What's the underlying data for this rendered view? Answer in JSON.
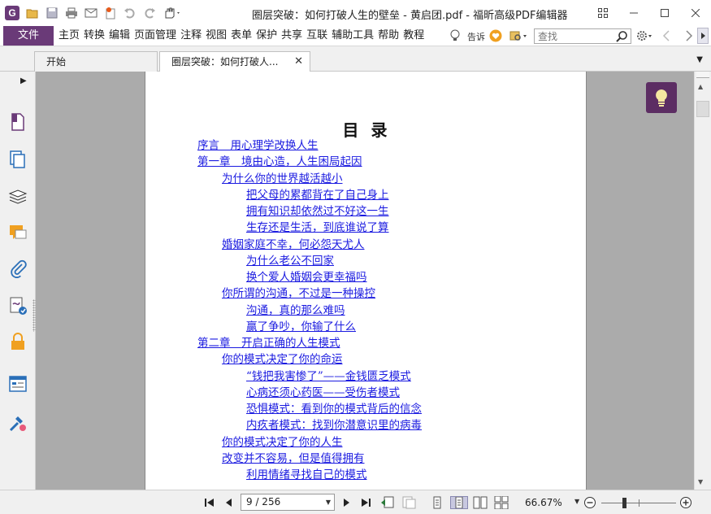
{
  "window": {
    "title": "圈层突破：如何打破人生的壁垒 - 黄启团.pdf - 福昕高级PDF编辑器",
    "app_logo": "G"
  },
  "menu": {
    "file_label": "文件",
    "items": [
      "主页",
      "转换",
      "编辑",
      "页面管理",
      "注释",
      "视图",
      "表单",
      "保护",
      "共享",
      "互联",
      "辅助工具",
      "帮助",
      "教程"
    ],
    "tell_label": "告诉",
    "search_placeholder": "查找"
  },
  "tabs": [
    {
      "label": "开始"
    },
    {
      "label": "圈层突破：如何打破人..."
    }
  ],
  "document": {
    "toc_title": "目 录",
    "entries": [
      {
        "level": 0,
        "text": "序言　用心理学改换人生"
      },
      {
        "level": 0,
        "text": "第一章　境由心造，人生困局起因"
      },
      {
        "level": 1,
        "text": "为什么你的世界越活越小"
      },
      {
        "level": 2,
        "text": "把父母的累都背在了自己身上"
      },
      {
        "level": 2,
        "text": "拥有知识却依然过不好这一生"
      },
      {
        "level": 2,
        "text": "生存还是生活，到底谁说了算"
      },
      {
        "level": 1,
        "text": "婚姻家庭不幸，何必怨天尤人"
      },
      {
        "level": 2,
        "text": "为什么老公不回家"
      },
      {
        "level": 2,
        "text": "换个爱人婚姻会更幸福吗"
      },
      {
        "level": 1,
        "text": "你所谓的沟通，不过是一种操控"
      },
      {
        "level": 2,
        "text": "沟通，真的那么难吗"
      },
      {
        "level": 2,
        "text": "赢了争吵，你输了什么"
      },
      {
        "level": 0,
        "text": "第二章　开启正确的人生模式"
      },
      {
        "level": 1,
        "text": "你的模式决定了你的命运"
      },
      {
        "level": 2,
        "text": "“钱把我害惨了”——金钱匮乏模式"
      },
      {
        "level": 2,
        "text": "心病还须心药医——受伤者模式"
      },
      {
        "level": 2,
        "text": "恐惧模式：看到你的模式背后的信念"
      },
      {
        "level": 2,
        "text": "内疚者模式：找到你潜意识里的病毒"
      },
      {
        "level": 1,
        "text": "你的模式决定了你的人生"
      },
      {
        "level": 1,
        "text": "改变并不容易，但是值得拥有"
      },
      {
        "level": 2,
        "text": "利用情绪寻找自己的模式"
      }
    ]
  },
  "status": {
    "page_display": "9 / 256",
    "current_page": 9,
    "total_pages": 256,
    "zoom": "66.67%"
  },
  "colors": {
    "brand": "#6a3a78",
    "link": "#1a1ae0",
    "workspace": "#ababab"
  }
}
